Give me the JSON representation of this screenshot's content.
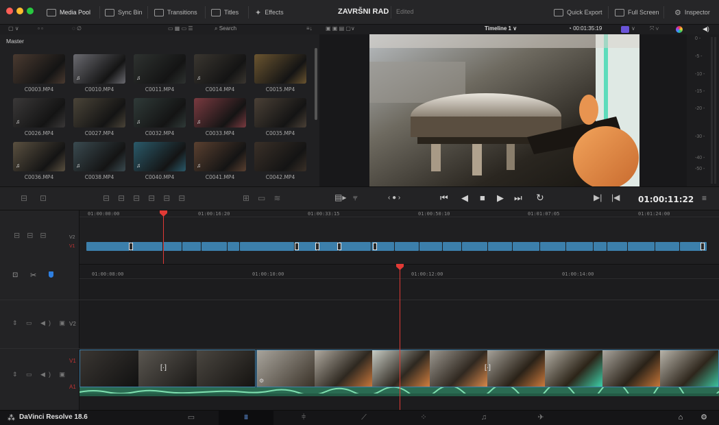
{
  "titlebar": {
    "media_pool": "Media Pool",
    "sync_bin": "Sync Bin",
    "transitions": "Transitions",
    "titles": "Titles",
    "effects": "Effects",
    "project_title": "ZAVRŠNI RAD",
    "project_status": "Edited",
    "quick_export": "Quick Export",
    "full_screen": "Full Screen",
    "inspector": "Inspector"
  },
  "toolbar": {
    "search_label": "Search",
    "timeline_name": "Timeline 1",
    "duration_tc": "00:01:35:19"
  },
  "media_pool": {
    "bin_name": "Master",
    "clips": [
      {
        "name": "C0003.MP4",
        "color": "#4a3a30",
        "audio": false
      },
      {
        "name": "C0010.MP4",
        "color": "#6a6a70",
        "audio": true
      },
      {
        "name": "C0011.MP4",
        "color": "#2e3230",
        "audio": true
      },
      {
        "name": "C0014.MP4",
        "color": "#3a3630",
        "audio": true
      },
      {
        "name": "C0015.MP4",
        "color": "#6b5530",
        "audio": false
      },
      {
        "name": "C0026.MP4",
        "color": "#3a3838",
        "audio": true
      },
      {
        "name": "C0027.MP4",
        "color": "#4a4438",
        "audio": false
      },
      {
        "name": "C0032.MP4",
        "color": "#2f3a38",
        "audio": true
      },
      {
        "name": "C0033.MP4",
        "color": "#7a3a40",
        "audio": true
      },
      {
        "name": "C0035.MP4",
        "color": "#4a4036",
        "audio": false
      },
      {
        "name": "C0036.MP4",
        "color": "#5a5040",
        "audio": true
      },
      {
        "name": "C0038.MP4",
        "color": "#3a4a50",
        "audio": true
      },
      {
        "name": "C0040.MP4",
        "color": "#2a5a6a",
        "audio": true
      },
      {
        "name": "C0041.MP4",
        "color": "#5a4030",
        "audio": true
      },
      {
        "name": "C0042.MP4",
        "color": "#3a3028",
        "audio": false
      }
    ]
  },
  "meter": {
    "labels": [
      "0 -",
      "-5 -",
      "-10 -",
      "-15 -",
      "-20 -",
      "-30 -",
      "-40 -",
      "-50 -"
    ]
  },
  "transport": {
    "timecode": "01:00:11:22"
  },
  "upper_timeline": {
    "ruler": [
      "01:00:00:00",
      "01:00:16:20",
      "01:00:33:15",
      "01:00:50:10",
      "01:01:07:05",
      "01:01:24:00"
    ],
    "track_v2": "V2",
    "track_v1": "V1"
  },
  "lower_timeline": {
    "ruler": [
      "01:00:08:00",
      "01:00:10:00",
      "01:00:12:00",
      "01:00:14:00"
    ],
    "track_v2": "V2",
    "track_v1": "V1",
    "track_a1": "A1"
  },
  "footer": {
    "brand": "DaVinci Resolve 18.6"
  }
}
